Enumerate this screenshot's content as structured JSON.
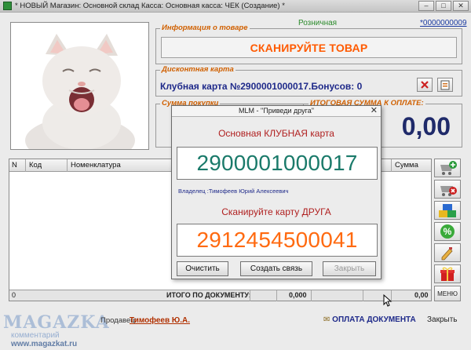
{
  "window": {
    "title": "* НОВЫЙ Магазин: Основной склад Касса: Основная касса: ЧЕК (Создание) *"
  },
  "header": {
    "mode": "Розничная",
    "doc_number": "*0000000009"
  },
  "product_info": {
    "title": "Информация о товаре",
    "scan_prompt": "СКАНИРУЙТЕ ТОВАР"
  },
  "discount_card": {
    "title": "Дисконтная карта",
    "value": "Клубная карта №2900001000017.Бонусов: 0"
  },
  "purchase_sum": {
    "title": "Сумма покупки"
  },
  "total_due": {
    "title": "ИТОГОВАЯ СУММА К ОПЛАТЕ:",
    "value": "0,00"
  },
  "table": {
    "columns": [
      "N",
      "Код",
      "Номенклатура",
      "Сумма"
    ],
    "footer": {
      "count": "0",
      "label": "ИТОГО ПО ДОКУМЕНТУ:",
      "sum1": "0,000",
      "sum2": "0,00"
    }
  },
  "toolbar": {
    "menu_label": "МЕНЮ"
  },
  "footer": {
    "seller_label": "Продавец:",
    "seller_name": "Тимофеев Ю.А.",
    "pay_label": "ОПЛАТА ДОКУМЕНТА",
    "close_label": "Закрыть",
    "watermark_brand": "MAGAZKA",
    "watermark_comment": "комментарий",
    "watermark_site": "www.magazkat.ru"
  },
  "dialog": {
    "title": "MLM - \"Приведи друга\"",
    "primary_label": "Основная КЛУБНАЯ карта",
    "primary_number": "2900001000017",
    "owner": "Владелец :Тимофеев Юрий Алексеевич",
    "friend_label": "Сканируйте карту ДРУГА",
    "friend_number": "2912454500041",
    "btn_clear": "Очистить",
    "btn_link": "Создать связь",
    "btn_close": "Закрыть"
  },
  "colors": {
    "accent_orange": "#ff5a00",
    "card_blue": "#1f2a8a",
    "primary_number": "#1a7a6a",
    "friend_number": "#ff6a10",
    "dialog_label": "#b02020"
  }
}
